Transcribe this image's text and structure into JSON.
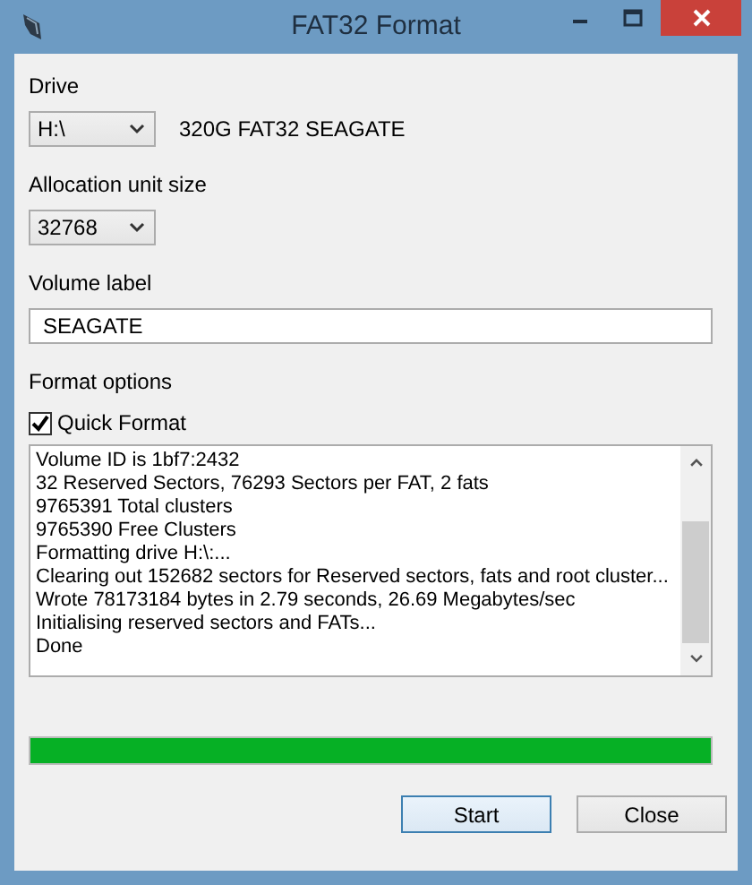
{
  "window": {
    "title": "FAT32 Format"
  },
  "drive": {
    "label": "Drive",
    "value": "H:\\",
    "info": "320G FAT32 SEAGATE"
  },
  "allocation": {
    "label": "Allocation unit size",
    "value": "32768"
  },
  "volume_label": {
    "label": "Volume label",
    "value": "SEAGATE"
  },
  "format_options": {
    "label": "Format options",
    "quick_format": {
      "label": "Quick Format",
      "checked": true
    }
  },
  "log_lines": [
    "Volume ID is 1bf7:2432",
    "32 Reserved Sectors, 76293 Sectors per FAT, 2 fats",
    "9765391 Total clusters",
    "9765390 Free Clusters",
    "Formatting drive H:\\:...",
    "Clearing out 152682 sectors for Reserved sectors, fats and root cluster...",
    "Wrote 78173184 bytes in 2.79 seconds, 26.69 Megabytes/sec",
    "Initialising reserved sectors and FATs...",
    "Done"
  ],
  "progress": {
    "level": 1
  },
  "buttons": [
    {
      "label": "Start",
      "kind": "default"
    },
    {
      "label": "Close",
      "kind": "normal"
    }
  ]
}
